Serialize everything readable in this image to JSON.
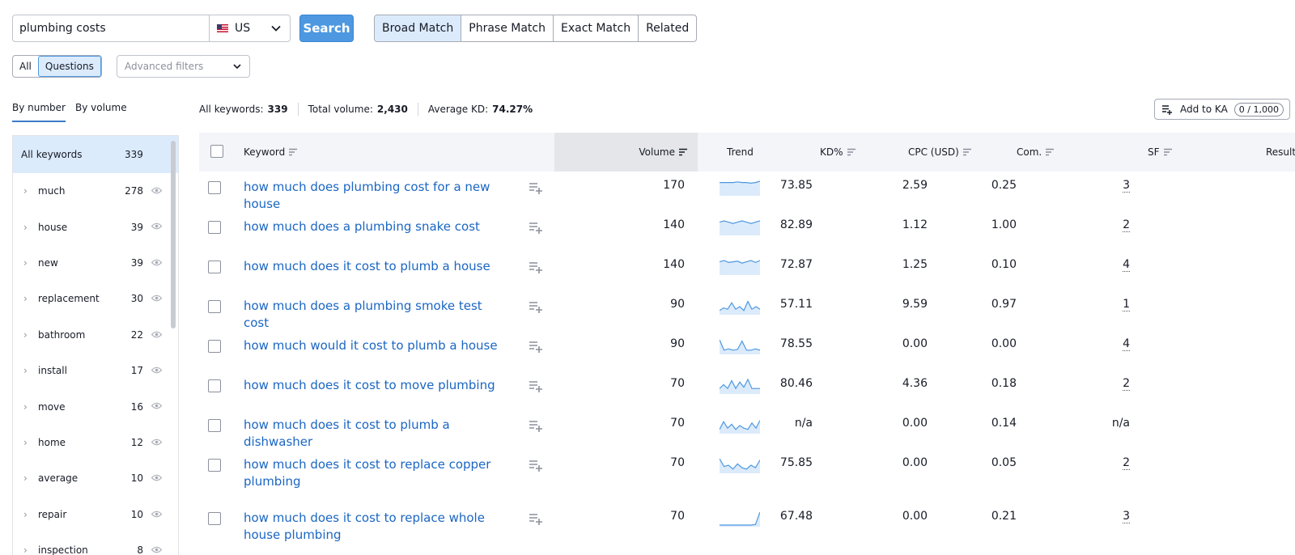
{
  "search": {
    "query": "plumbing costs",
    "country": "US",
    "search_button": "Search"
  },
  "match_tabs": [
    "Broad Match",
    "Phrase Match",
    "Exact Match",
    "Related"
  ],
  "match_active": "Broad Match",
  "filter": {
    "all_label": "All",
    "questions_label": "Questions",
    "advanced_filters": "Advanced filters"
  },
  "group_tabs": {
    "by_number": "By number",
    "by_volume": "By volume"
  },
  "stats": {
    "all_keywords_label": "All keywords:",
    "all_keywords_value": "339",
    "total_volume_label": "Total volume:",
    "total_volume_value": "2,430",
    "avg_kd_label": "Average KD:",
    "avg_kd_value": "74.27%"
  },
  "add_ka": {
    "label": "Add to KA",
    "count": "0 / 1,000"
  },
  "sidebar": {
    "all_label": "All keywords",
    "all_count": "339",
    "items": [
      {
        "label": "much",
        "count": "278"
      },
      {
        "label": "house",
        "count": "39"
      },
      {
        "label": "new",
        "count": "39"
      },
      {
        "label": "replacement",
        "count": "30"
      },
      {
        "label": "bathroom",
        "count": "22"
      },
      {
        "label": "install",
        "count": "17"
      },
      {
        "label": "move",
        "count": "16"
      },
      {
        "label": "home",
        "count": "12"
      },
      {
        "label": "average",
        "count": "10"
      },
      {
        "label": "repair",
        "count": "10"
      },
      {
        "label": "inspection",
        "count": "8"
      }
    ]
  },
  "table": {
    "headers": {
      "keyword": "Keyword",
      "volume": "Volume",
      "trend": "Trend",
      "kd": "KD%",
      "cpc": "CPC (USD)",
      "com": "Com.",
      "sf": "SF",
      "results": "Result"
    },
    "rows": [
      {
        "keyword": "how much does plumbing cost for a new house",
        "volume": "170",
        "kd": "73.85",
        "cpc": "2.59",
        "com": "0.25",
        "sf": "3",
        "trend": [
          0.9,
          0.9,
          0.9,
          0.9,
          0.95,
          0.9,
          0.9,
          0.85,
          0.9,
          1
        ]
      },
      {
        "keyword": "how much does a plumbing snake cost",
        "volume": "140",
        "kd": "82.89",
        "cpc": "1.12",
        "com": "1.00",
        "sf": "2",
        "trend": [
          0.9,
          1,
          0.9,
          0.8,
          0.9,
          1,
          0.9,
          0.8,
          0.9,
          1
        ]
      },
      {
        "keyword": "how much does it cost to plumb a house",
        "volume": "140",
        "kd": "72.87",
        "cpc": "1.25",
        "com": "0.10",
        "sf": "4",
        "trend": [
          0.9,
          1,
          0.85,
          0.9,
          0.95,
          0.8,
          0.9,
          1,
          0.85,
          1
        ]
      },
      {
        "keyword": "how much does a plumbing smoke test cost",
        "volume": "90",
        "kd": "57.11",
        "cpc": "9.59",
        "com": "0.97",
        "sf": "1",
        "trend": [
          0.2,
          0.4,
          0.3,
          0.8,
          0.3,
          0.5,
          0.2,
          0.9,
          0.3,
          0.5,
          0.3
        ]
      },
      {
        "keyword": "how much would it cost to plumb a house",
        "volume": "90",
        "kd": "78.55",
        "cpc": "0.00",
        "com": "0.00",
        "sf": "4",
        "trend": [
          1,
          0.2,
          0.3,
          0.2,
          0.25,
          0.9,
          0.2,
          0.2,
          0.3,
          0.2
        ]
      },
      {
        "keyword": "how much does it cost to move plumbing",
        "volume": "70",
        "kd": "80.46",
        "cpc": "4.36",
        "com": "0.18",
        "sf": "2",
        "trend": [
          0.3,
          0.6,
          0.3,
          0.9,
          0.3,
          0.8,
          0.4,
          1,
          0.3,
          0.3,
          0.3
        ]
      },
      {
        "keyword": "how much does it cost to plumb a dishwasher",
        "volume": "70",
        "kd": "n/a",
        "cpc": "0.00",
        "com": "0.14",
        "sf": "n/a",
        "trend": [
          0.2,
          0.8,
          0.3,
          0.6,
          0.2,
          0.5,
          0.3,
          0.2,
          0.7,
          0.3,
          0.9
        ]
      },
      {
        "keyword": "how much does it cost to replace copper plumbing",
        "volume": "70",
        "kd": "75.85",
        "cpc": "0.00",
        "com": "0.05",
        "sf": "2",
        "trend": [
          1,
          0.4,
          0.5,
          0.2,
          0.6,
          0.3,
          0.2,
          0.5,
          0.3,
          0.9
        ]
      },
      {
        "keyword": "how much does it cost to replace whole house plumbing",
        "volume": "70",
        "kd": "67.48",
        "cpc": "0.00",
        "com": "0.21",
        "sf": "3",
        "trend": [
          0,
          0,
          0,
          0,
          0,
          0,
          0,
          0,
          0.05,
          1
        ]
      }
    ]
  },
  "colors": {
    "accent": "#4d98e0",
    "link": "#1b66c3",
    "active_bg": "#dcebfb",
    "trend_line": "#4d98e0",
    "trend_fill": "#dcebfb"
  }
}
